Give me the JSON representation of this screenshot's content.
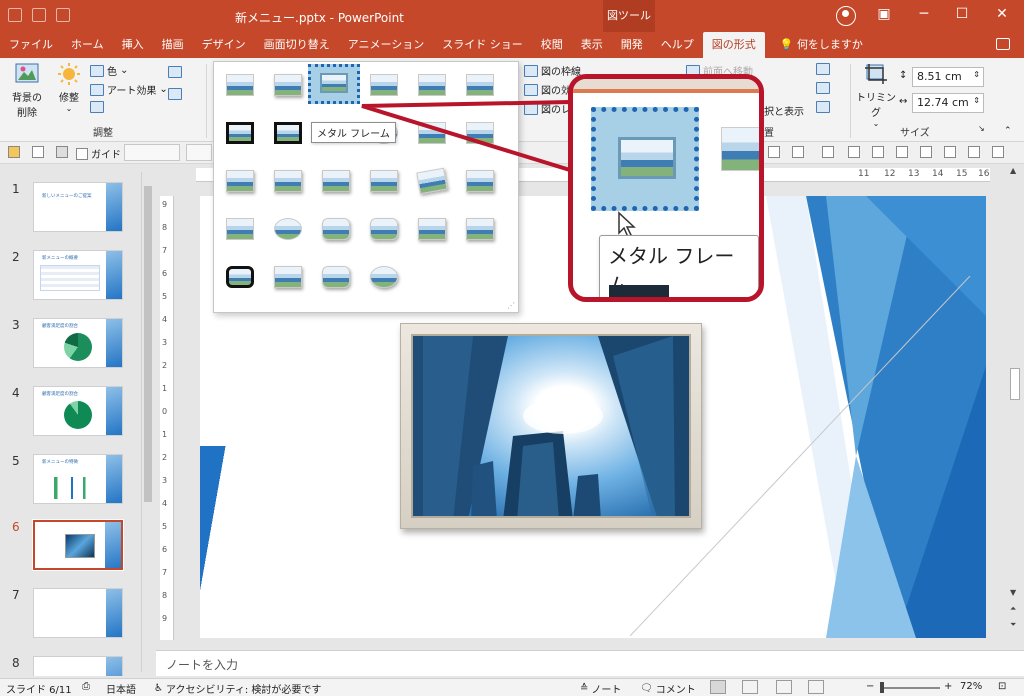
{
  "window": {
    "title": "新メニュー.pptx  -  PowerPoint",
    "context_tab": "図ツール",
    "minimize": "─",
    "maximize": "☐",
    "close": "✕"
  },
  "tabs": [
    "ファイル",
    "ホーム",
    "挿入",
    "描画",
    "デザイン",
    "画面切り替え",
    "アニメーション",
    "スライド ショー",
    "校閲",
    "表示",
    "開発",
    "ヘルプ",
    "図の形式"
  ],
  "active_tab": "図の形式",
  "search_tab": "何をしますか",
  "ribbon": {
    "remove_bg": [
      "背景の",
      "削除"
    ],
    "corrections": "修整",
    "color": "色",
    "art_effects": "アート効果",
    "adjust_group": "調整",
    "border": "図の枠線",
    "effects": "図の効果",
    "layout_partial": "図のレ",
    "bring_forward": "前面へ移動",
    "selection_pane": "択と表示",
    "arrange_partial": "置",
    "crop": "トリミング",
    "height": "8.51 cm",
    "width": "12.74 cm",
    "size_group": "サイズ"
  },
  "gallery": {
    "tooltip": "メタル フレーム"
  },
  "callout": {
    "tooltip": "メタル フレーム"
  },
  "toolrow": {
    "guide": "ガイド"
  },
  "hruler_ticks": [
    "11",
    "12",
    "13",
    "14",
    "15",
    "16"
  ],
  "vruler_ticks": [
    "9",
    "8",
    "7",
    "6",
    "5",
    "4",
    "3",
    "2",
    "1",
    "0",
    "1",
    "2",
    "3",
    "4",
    "5",
    "6",
    "7",
    "8",
    "9"
  ],
  "slides": [
    {
      "num": "1",
      "title": "新しいメニューのご提案"
    },
    {
      "num": "2",
      "title": "新メニューの概要"
    },
    {
      "num": "3",
      "title": "顧客満足度の割合"
    },
    {
      "num": "4",
      "title": "顧客満足度の割合"
    },
    {
      "num": "5",
      "title": "新メニューの特徴"
    },
    {
      "num": "6",
      "title": ""
    },
    {
      "num": "7",
      "title": ""
    },
    {
      "num": "8",
      "title": ""
    }
  ],
  "active_slide": "6",
  "notes_placeholder": "ノートを入力",
  "status": {
    "slide": "スライド 6/11",
    "language": "日本語",
    "accessibility": "アクセシビリティ: 検討が必要です",
    "notes": "ノート",
    "comments": "コメント",
    "zoom": "72%",
    "minus": "−",
    "plus": "+"
  },
  "colors": {
    "accent": "#c5482a",
    "callout": "#b8152a",
    "selection": "#1f66b2"
  }
}
